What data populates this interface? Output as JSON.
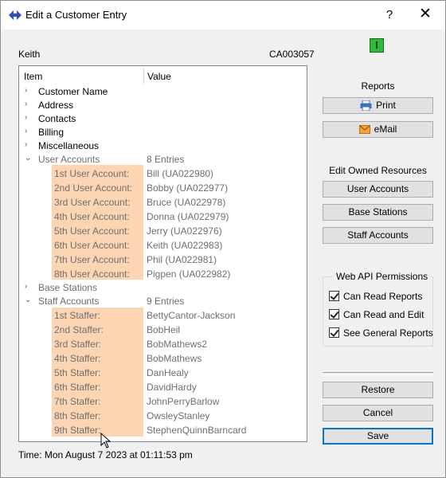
{
  "window": {
    "title": "Edit a Customer Entry",
    "help": "?",
    "close": "✕"
  },
  "customer": {
    "name": "Keith",
    "id": "CA003057"
  },
  "tree": {
    "col_item": "Item",
    "col_value": "Value",
    "categories": [
      {
        "label": "Customer Name",
        "chevron": "›"
      },
      {
        "label": "Address",
        "chevron": "›"
      },
      {
        "label": "Contacts",
        "chevron": "›"
      },
      {
        "label": "Billing",
        "chevron": "›"
      },
      {
        "label": "Miscellaneous",
        "chevron": "›"
      }
    ],
    "user_accounts": {
      "label": "User Accounts",
      "value": "8 Entries",
      "chevron": "⌄",
      "items": [
        {
          "label": "1st User Account:",
          "value": "Bill (UA022980)"
        },
        {
          "label": "2nd User Account:",
          "value": "Bobby (UA022977)"
        },
        {
          "label": "3rd User Account:",
          "value": "Bruce (UA022978)"
        },
        {
          "label": "4th User Account:",
          "value": "Donna (UA022979)"
        },
        {
          "label": "5th User Account:",
          "value": "Jerry (UA022976)"
        },
        {
          "label": "6th User Account:",
          "value": "Keith (UA022983)"
        },
        {
          "label": "7th User Account:",
          "value": "Phil (UA022981)"
        },
        {
          "label": "8th User Account:",
          "value": "Pigpen (UA022982)"
        }
      ]
    },
    "base_stations": {
      "label": "Base Stations",
      "chevron": "›"
    },
    "staff_accounts": {
      "label": "Staff Accounts",
      "value": "9 Entries",
      "chevron": "⌄",
      "items": [
        {
          "label": "1st Staffer:",
          "value": "BettyCantor-Jackson"
        },
        {
          "label": "2nd Staffer:",
          "value": "BobHeil"
        },
        {
          "label": "3rd Staffer:",
          "value": "BobMathews2"
        },
        {
          "label": "4th Staffer:",
          "value": "BobMathews"
        },
        {
          "label": "5th Staffer:",
          "value": "DanHealy"
        },
        {
          "label": "6th Staffer:",
          "value": "DavidHardy"
        },
        {
          "label": "7th Staffer:",
          "value": "JohnPerryBarlow"
        },
        {
          "label": "8th Staffer:",
          "value": "OwsleyStanley"
        },
        {
          "label": "9th Staffer:",
          "value": "StephenQuinnBarncard"
        }
      ]
    }
  },
  "status": {
    "time": "Time: Mon August 7 2023 at 01:11:53 pm"
  },
  "reports": {
    "heading": "Reports",
    "print": "Print",
    "email": "eMail"
  },
  "resources": {
    "heading": "Edit Owned Resources",
    "user_accounts": "User Accounts",
    "base_stations": "Base Stations",
    "staff_accounts": "Staff Accounts"
  },
  "permissions": {
    "heading": "Web API Permissions",
    "items": [
      "Can Read Reports",
      "Can Read and Edit",
      "See General Reports"
    ]
  },
  "actions": {
    "restore": "Restore",
    "cancel": "Cancel",
    "save": "Save"
  },
  "colors": {
    "highlight": "#fdd5b3",
    "indicator": "#2dbb38",
    "default_button_border": "#0078d7"
  }
}
